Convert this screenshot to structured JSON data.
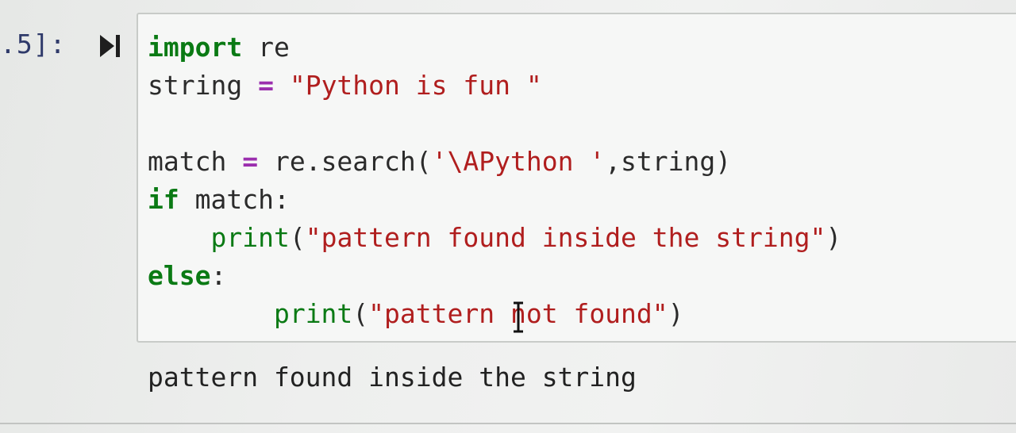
{
  "cell": {
    "prompt": ".5]:",
    "code_lines": [
      [
        {
          "t": "import",
          "c": "kw"
        },
        {
          "t": " re",
          "c": ""
        }
      ],
      [
        {
          "t": "string ",
          "c": ""
        },
        {
          "t": "=",
          "c": "op"
        },
        {
          "t": " ",
          "c": ""
        },
        {
          "t": "\"Python is fun \"",
          "c": "str"
        }
      ],
      [],
      [
        {
          "t": "match ",
          "c": ""
        },
        {
          "t": "=",
          "c": "op"
        },
        {
          "t": " re.search(",
          "c": ""
        },
        {
          "t": "'\\APython '",
          "c": "str"
        },
        {
          "t": ",string)",
          "c": ""
        }
      ],
      [
        {
          "t": "if",
          "c": "kw"
        },
        {
          "t": " match:",
          "c": ""
        }
      ],
      [
        {
          "t": "    ",
          "c": ""
        },
        {
          "t": "print",
          "c": "bi"
        },
        {
          "t": "(",
          "c": ""
        },
        {
          "t": "\"pattern found inside the string\"",
          "c": "str"
        },
        {
          "t": ")",
          "c": ""
        }
      ],
      [
        {
          "t": "else",
          "c": "kw"
        },
        {
          "t": ":",
          "c": ""
        }
      ],
      [
        {
          "t": "        ",
          "c": ""
        },
        {
          "t": "print",
          "c": "bi"
        },
        {
          "t": "(",
          "c": ""
        },
        {
          "t": "\"pattern not found\"",
          "c": "str"
        },
        {
          "t": ")",
          "c": ""
        }
      ]
    ],
    "output": "pattern found inside the string"
  },
  "icons": {
    "run": "run-cell-icon",
    "cursor": "text-cursor-icon"
  },
  "colors": {
    "keyword": "#0a7a14",
    "operator": "#9b2fae",
    "string": "#b01e1e",
    "prompt": "#2f3a6a"
  }
}
